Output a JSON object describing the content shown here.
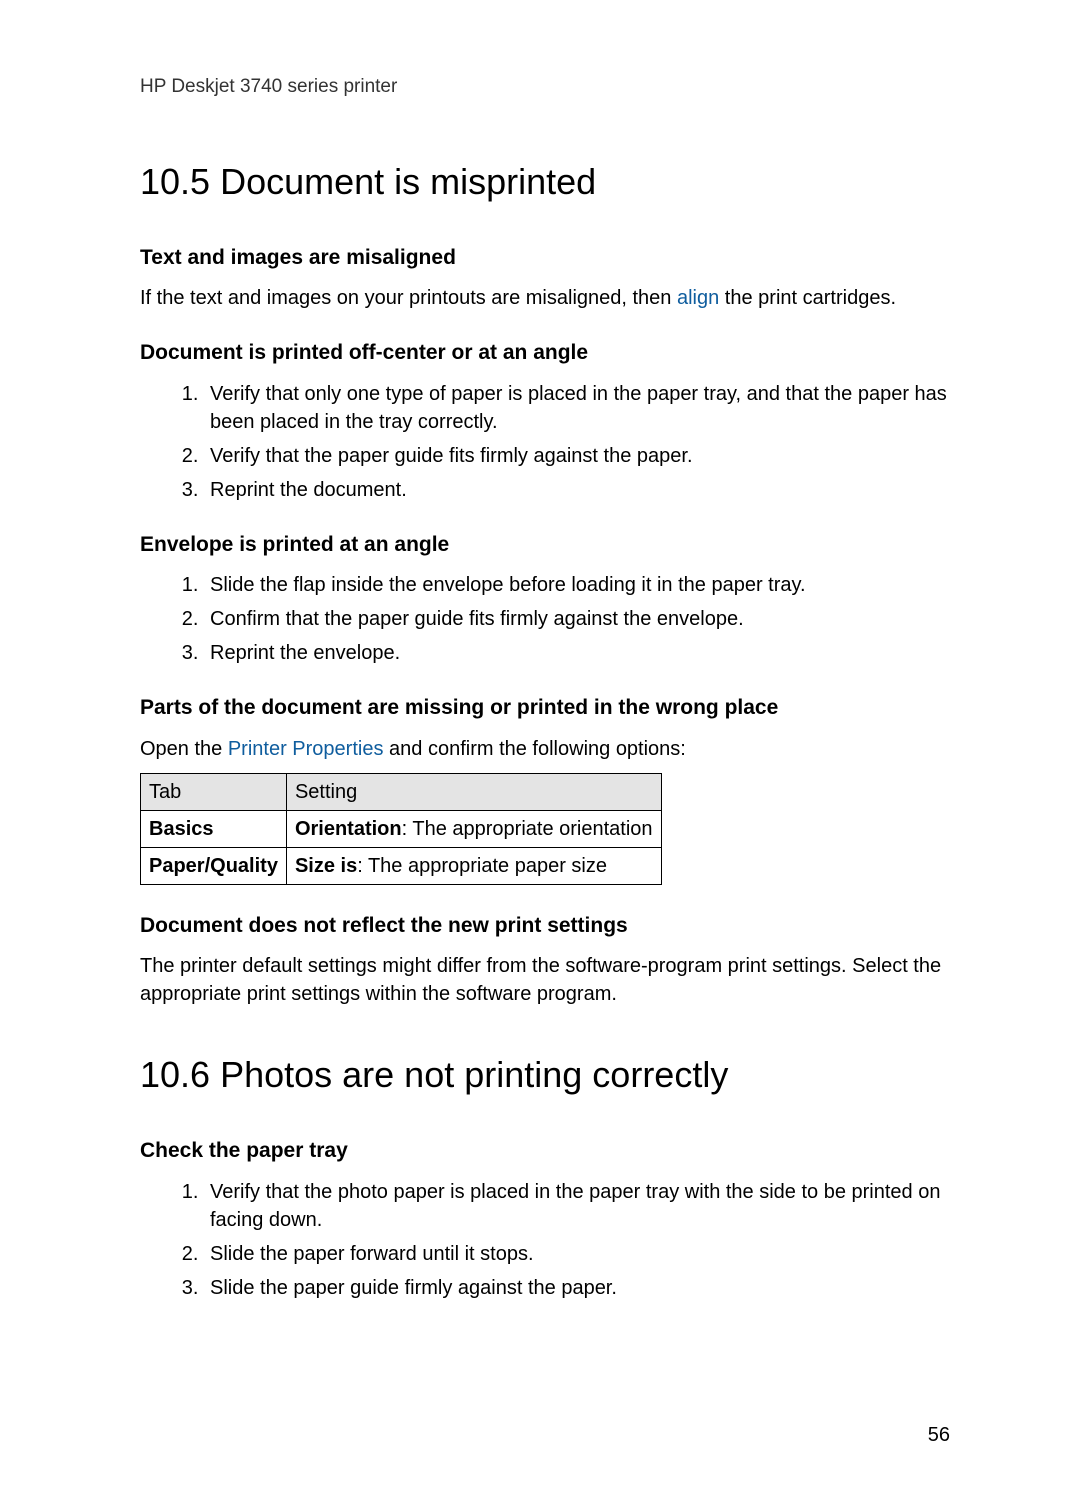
{
  "header": {
    "product_line": "HP Deskjet 3740 series printer"
  },
  "section_10_5": {
    "heading": "10.5  Document is misprinted",
    "sub1": {
      "heading": "Text and images are misaligned",
      "para_pre": "If the text and images on your printouts are misaligned, then ",
      "link": "align",
      "para_post": " the print cartridges."
    },
    "sub2": {
      "heading": "Document is printed off-center or at an angle",
      "steps": [
        "Verify that only one type of paper is placed in the paper tray, and that the paper has been placed in the tray correctly.",
        "Verify that the paper guide fits firmly against the paper.",
        "Reprint the document."
      ]
    },
    "sub3": {
      "heading": "Envelope is printed at an angle",
      "steps": [
        "Slide the flap inside the envelope before loading it in the paper tray.",
        "Confirm that the paper guide fits firmly against the envelope.",
        "Reprint the envelope."
      ]
    },
    "sub4": {
      "heading": "Parts of the document are missing or printed in the wrong place",
      "para_pre": "Open the ",
      "link": "Printer Properties",
      "para_post": " and confirm the following options:",
      "table": {
        "headers": [
          "Tab",
          "Setting"
        ],
        "rows": [
          {
            "tab": "Basics",
            "label": "Orientation",
            "rest": ": The appropriate orientation"
          },
          {
            "tab": "Paper/Quality",
            "label": "Size is",
            "rest": ": The appropriate paper size"
          }
        ]
      }
    },
    "sub5": {
      "heading": "Document does not reflect the new print settings",
      "para": "The printer default settings might differ from the software-program print settings. Select the appropriate print settings within the software program."
    }
  },
  "section_10_6": {
    "heading": "10.6  Photos are not printing correctly",
    "sub1": {
      "heading": "Check the paper tray",
      "steps": [
        "Verify that the photo paper is placed in the paper tray with the side to be printed on facing down.",
        "Slide the paper forward until it stops.",
        "Slide the paper guide firmly against the paper."
      ]
    }
  },
  "page_number": "56"
}
